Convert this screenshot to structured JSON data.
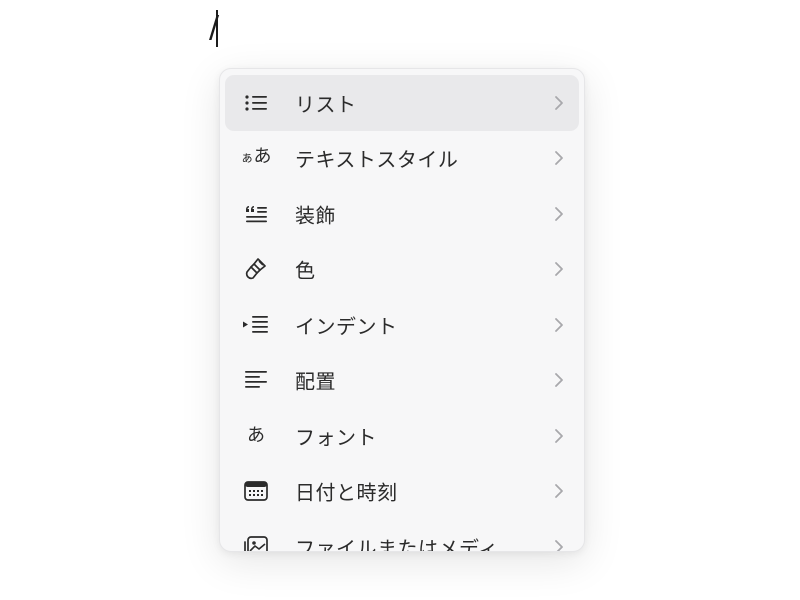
{
  "editor": {
    "typed_text": "/"
  },
  "menu": {
    "items": [
      {
        "label": "リスト",
        "icon": "bullet-list-icon",
        "highlighted": true
      },
      {
        "label": "テキストスタイル",
        "icon": "text-style-icon",
        "icon_text_small": "ぁ",
        "icon_text": "あ"
      },
      {
        "label": "装飾",
        "icon": "quote-decoration-icon"
      },
      {
        "label": "色",
        "icon": "paintbrush-icon"
      },
      {
        "label": "インデント",
        "icon": "indent-icon"
      },
      {
        "label": "配置",
        "icon": "align-left-icon"
      },
      {
        "label": "フォント",
        "icon": "font-icon",
        "icon_text": "あ"
      },
      {
        "label": "日付と時刻",
        "icon": "calendar-icon"
      },
      {
        "label": "ファイルまたはメディ…",
        "icon": "media-icon"
      }
    ],
    "chevron_icon": "chevron-right-icon"
  }
}
